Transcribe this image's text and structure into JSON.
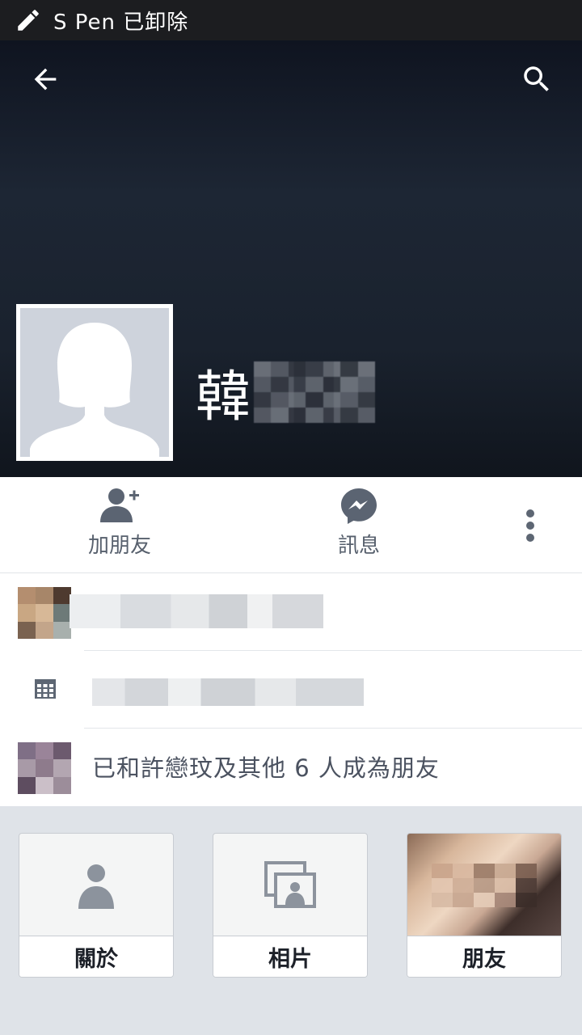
{
  "statusbar": {
    "text": "S Pen 已卸除",
    "icon": "pen-icon"
  },
  "header": {
    "back_icon": "back-arrow-icon",
    "search_icon": "search-icon"
  },
  "profile": {
    "name_visible": "韓",
    "avatar_icon": "default-avatar-female-icon"
  },
  "actions": {
    "add_friend": {
      "label": "加朋友",
      "icon": "add-friend-icon"
    },
    "message": {
      "label": "訊息",
      "icon": "messenger-icon"
    },
    "more_icon": "more-vertical-icon"
  },
  "info": {
    "mutual_friends": "已和許戀玟及其他 6 人成為朋友",
    "calendar_icon": "calendar-icon"
  },
  "cards": [
    {
      "label": "關於",
      "icon": "person-icon"
    },
    {
      "label": "相片",
      "icon": "photos-icon"
    },
    {
      "label": "朋友",
      "icon": "friends-photo"
    }
  ],
  "colors": {
    "cover_dark": "#131a25",
    "text_gray": "#57606d",
    "card_bg": "#f4f5f5",
    "page_bg": "#dfe3e8"
  }
}
